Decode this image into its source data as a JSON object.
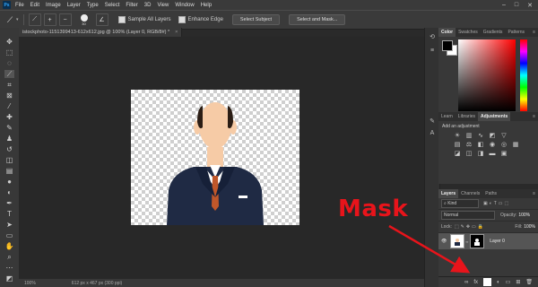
{
  "menubar": {
    "logo": "Ps",
    "items": [
      "File",
      "Edit",
      "Image",
      "Layer",
      "Type",
      "Select",
      "Filter",
      "3D",
      "View",
      "Window",
      "Help"
    ],
    "window_controls": [
      "–",
      "□",
      "✕"
    ]
  },
  "options_bar": {
    "brush_size": "30",
    "sample_all_layers": "Sample All Layers",
    "enhance_edge": "Enhance Edge",
    "select_subject": "Select Subject",
    "select_and_mask": "Select and Mask..."
  },
  "document": {
    "tab_title": "istockphoto-1151399413-612x612.jpg @ 100% (Layer 0, RGB/8#) *",
    "close": "×",
    "zoom": "100%",
    "dimensions": "612 px x 467 px (300 ppi)"
  },
  "color_panel": {
    "tabs": [
      "Color",
      "Swatches",
      "Gradients",
      "Patterns"
    ],
    "foreground": "#000000",
    "background": "#ffffff"
  },
  "adjustments_panel": {
    "tabs": [
      "Learn",
      "Libraries",
      "Adjustments"
    ],
    "title": "Add an adjustment"
  },
  "layers_panel": {
    "tabs": [
      "Layers",
      "Channels",
      "Paths"
    ],
    "filter_kind": "Kind",
    "blend_mode": "Normal",
    "opacity_label": "Opacity:",
    "opacity_value": "100%",
    "lock_label": "Lock:",
    "fill_label": "Fill:",
    "fill_value": "100%",
    "layer_name": "Layer 0"
  },
  "annotation": {
    "text": "Mask",
    "color": "#e8141b"
  },
  "colors": {
    "suit": "#1f2a44",
    "skin": "#f6cba6",
    "tie": "#c0572a"
  }
}
